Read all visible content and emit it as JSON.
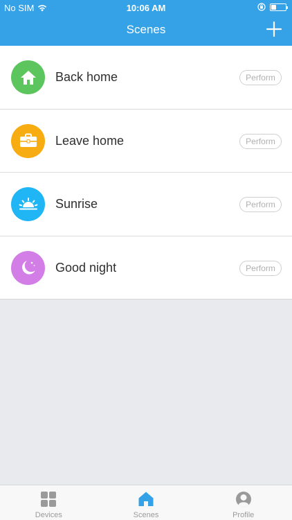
{
  "status_bar": {
    "carrier": "No SIM",
    "time": "10:06 AM",
    "battery_level": 0.35
  },
  "header": {
    "title": "Scenes",
    "add_icon": "plus-icon"
  },
  "scenes": [
    {
      "name": "Back home",
      "icon": "house-icon",
      "color": "#5cc55d",
      "action_label": "Perform"
    },
    {
      "name": "Leave home",
      "icon": "briefcase-icon",
      "color": "#f7ac12",
      "action_label": "Perform"
    },
    {
      "name": "Sunrise",
      "icon": "sunrise-icon",
      "color": "#20b5f4",
      "action_label": "Perform"
    },
    {
      "name": "Good night",
      "icon": "moon-icon",
      "color": "#d27ee6",
      "action_label": "Perform"
    }
  ],
  "tabbar": {
    "items": [
      {
        "label": "Devices",
        "icon": "grid-icon",
        "active": false
      },
      {
        "label": "Scenes",
        "icon": "house-icon",
        "active": true
      },
      {
        "label": "Profile",
        "icon": "person-icon",
        "active": false
      }
    ]
  },
  "colors": {
    "accent": "#35a2e8",
    "background": "#e9eaee"
  }
}
